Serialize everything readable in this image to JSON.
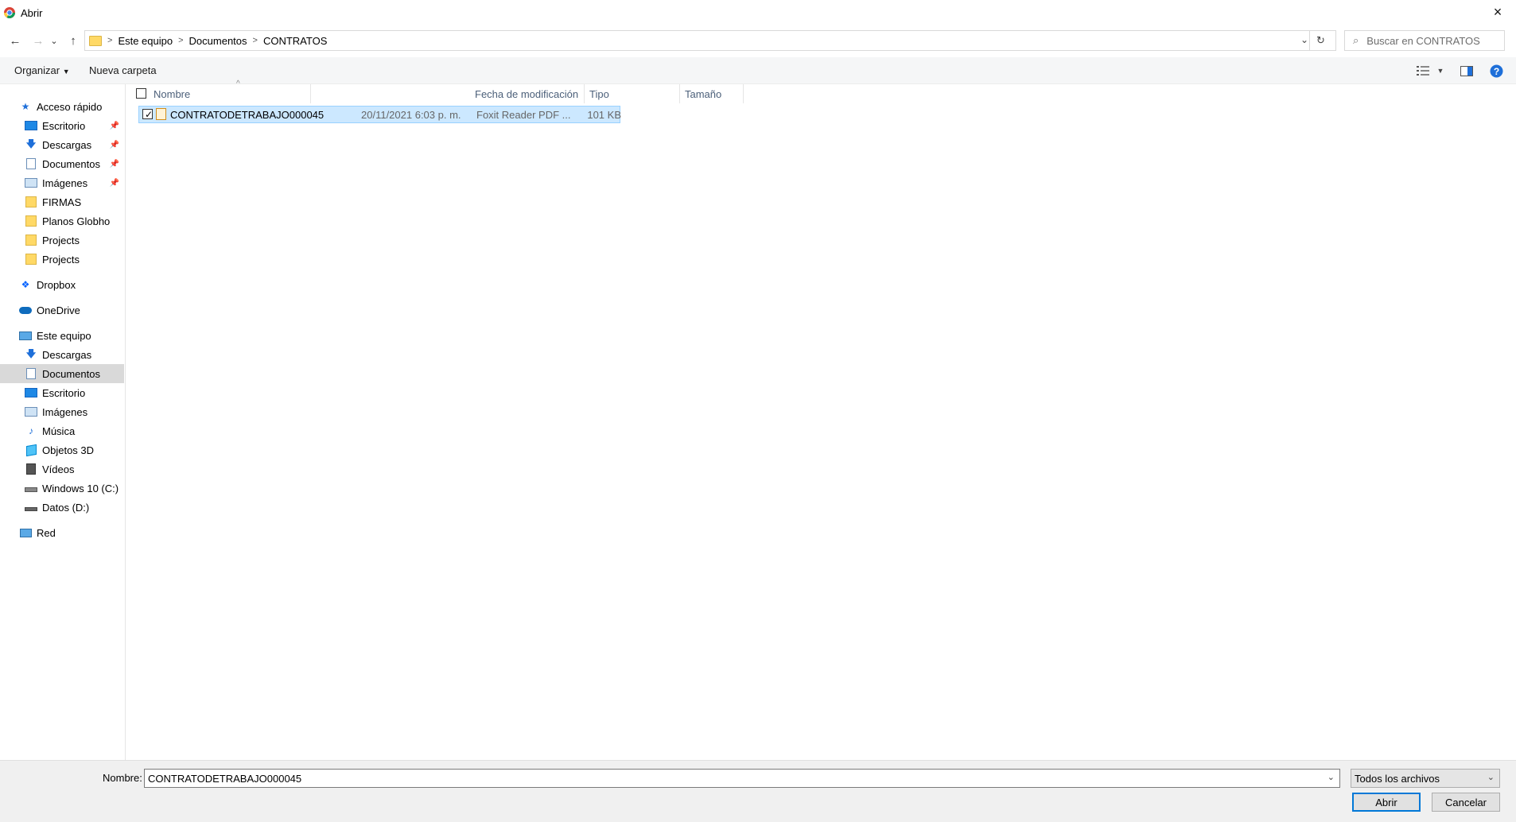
{
  "window": {
    "title": "Abrir",
    "close_icon": "×"
  },
  "nav": {
    "back": "←",
    "forward": "→",
    "recent": "⌄",
    "up": "↑"
  },
  "breadcrumb": [
    "Este equipo",
    "Documentos",
    "CONTRATOS"
  ],
  "search": {
    "placeholder": "Buscar en CONTRATOS"
  },
  "toolbar": {
    "organize": "Organizar",
    "new_folder": "Nueva carpeta"
  },
  "sidebar": {
    "quick_access": "Acceso rápido",
    "quick_items": [
      {
        "label": "Escritorio",
        "icon": "desktop-icon",
        "pinned": true
      },
      {
        "label": "Descargas",
        "icon": "download-icon",
        "pinned": true
      },
      {
        "label": "Documentos",
        "icon": "documents-icon",
        "pinned": true
      },
      {
        "label": "Imágenes",
        "icon": "pictures-icon",
        "pinned": true
      },
      {
        "label": "FIRMAS",
        "icon": "folder-icon",
        "pinned": false
      },
      {
        "label": "Planos Globho",
        "icon": "folder-icon",
        "pinned": false
      },
      {
        "label": "Projects",
        "icon": "folder-icon",
        "pinned": false
      },
      {
        "label": "Projects",
        "icon": "folder-icon",
        "pinned": false
      }
    ],
    "dropbox": "Dropbox",
    "onedrive": "OneDrive",
    "this_pc": "Este equipo",
    "pc_items": [
      {
        "label": "Descargas",
        "icon": "download-icon"
      },
      {
        "label": "Documentos",
        "icon": "documents-icon",
        "selected": true
      },
      {
        "label": "Escritorio",
        "icon": "desktop-icon"
      },
      {
        "label": "Imágenes",
        "icon": "pictures-icon"
      },
      {
        "label": "Música",
        "icon": "music-icon"
      },
      {
        "label": "Objetos 3D",
        "icon": "3d-objects-icon"
      },
      {
        "label": "Vídeos",
        "icon": "videos-icon"
      },
      {
        "label": "Windows 10 (C:)",
        "icon": "drive-c-icon"
      },
      {
        "label": "Datos (D:)",
        "icon": "drive-d-icon"
      }
    ],
    "network": "Red"
  },
  "columns": [
    "Nombre",
    "Fecha de modificación",
    "Tipo",
    "Tamaño"
  ],
  "files": [
    {
      "name": "CONTRATODETRABAJO000045",
      "modified": "20/11/2021 6:03 p. m.",
      "type": "Foxit Reader PDF ...",
      "size": "101 KB",
      "selected": true
    }
  ],
  "footer": {
    "filename_label": "Nombre:",
    "filename_value": "CONTRATODETRABAJO000045",
    "filter_value": "Todos los archivos",
    "open_button": "Abrir",
    "cancel_button": "Cancelar"
  },
  "colors": {
    "selection_bg": "#cce8ff",
    "selection_border": "#99d1ff",
    "sidebar_selected": "#d9d9d9",
    "accent": "#0078d7"
  }
}
